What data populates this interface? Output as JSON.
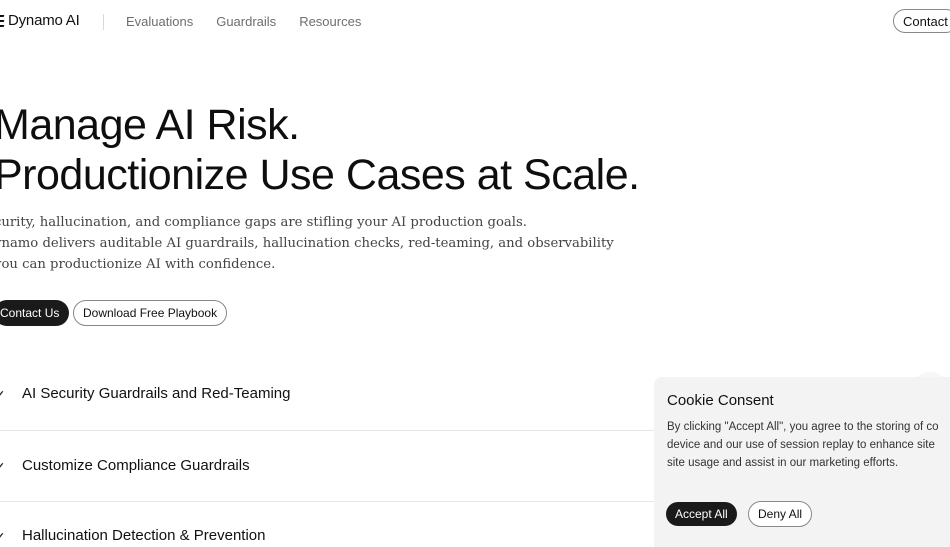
{
  "header": {
    "logo_text": "Dynamo AI",
    "nav": [
      "Evaluations",
      "Guardrails",
      "Resources"
    ],
    "contact_label": "Contact"
  },
  "hero": {
    "title_line1": "Manage AI Risk.",
    "title_line2": "Productionize Use Cases at Scale.",
    "copy_line1": "curity, hallucination, and compliance gaps are stifling your AI production goals.",
    "copy_line2": "ynamo delivers auditable AI guardrails, hallucination checks, red-teaming, and observability",
    "copy_line3": " you can productionize AI with confidence.",
    "cta_primary": "Contact Us",
    "cta_secondary": "Download Free Playbook"
  },
  "features": [
    {
      "label": "AI Security Guardrails and Red-Teaming"
    },
    {
      "label": "Customize Compliance Guardrails"
    },
    {
      "label": "Hallucination Detection & Prevention"
    }
  ],
  "icons": {
    "logo": "logo-mark-icon",
    "feature": "check-icon"
  },
  "cookie": {
    "title": "Cookie Consent",
    "text_line1": "By clicking \"Accept All\", you agree to the storing of co",
    "text_line2": "device and our use of session replay to enhance site",
    "text_line3": "site usage and assist in our marketing efforts.",
    "accept_label": "Accept All",
    "deny_label": "Deny All"
  },
  "colors": {
    "primary_button": "#1a1a1a",
    "background": "#ffffff",
    "cookie_background": "#f3f3f3"
  }
}
